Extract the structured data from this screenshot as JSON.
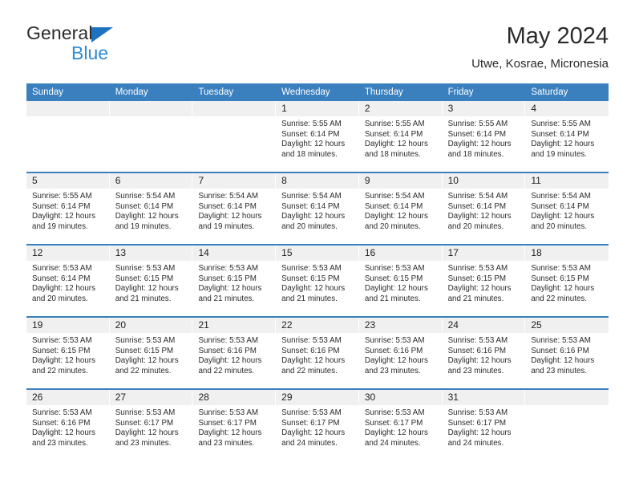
{
  "brand": {
    "name_part1": "General",
    "name_part2": "Blue",
    "accent_color": "#2e8bd4",
    "triangle_color": "#1d72c2"
  },
  "header": {
    "title": "May 2024",
    "subtitle": "Utwe, Kosrae, Micronesia"
  },
  "calendar": {
    "header_color": "#3a7fbe",
    "day_band_color": "#f0f0f0",
    "weekdays": [
      "Sunday",
      "Monday",
      "Tuesday",
      "Wednesday",
      "Thursday",
      "Friday",
      "Saturday"
    ],
    "weeks": [
      [
        {
          "day": "",
          "empty": true,
          "lines": []
        },
        {
          "day": "",
          "empty": true,
          "lines": []
        },
        {
          "day": "",
          "empty": true,
          "lines": []
        },
        {
          "day": "1",
          "lines": [
            "Sunrise: 5:55 AM",
            "Sunset: 6:14 PM",
            "Daylight: 12 hours",
            "and 18 minutes."
          ]
        },
        {
          "day": "2",
          "lines": [
            "Sunrise: 5:55 AM",
            "Sunset: 6:14 PM",
            "Daylight: 12 hours",
            "and 18 minutes."
          ]
        },
        {
          "day": "3",
          "lines": [
            "Sunrise: 5:55 AM",
            "Sunset: 6:14 PM",
            "Daylight: 12 hours",
            "and 18 minutes."
          ]
        },
        {
          "day": "4",
          "lines": [
            "Sunrise: 5:55 AM",
            "Sunset: 6:14 PM",
            "Daylight: 12 hours",
            "and 19 minutes."
          ]
        }
      ],
      [
        {
          "day": "5",
          "lines": [
            "Sunrise: 5:55 AM",
            "Sunset: 6:14 PM",
            "Daylight: 12 hours",
            "and 19 minutes."
          ]
        },
        {
          "day": "6",
          "lines": [
            "Sunrise: 5:54 AM",
            "Sunset: 6:14 PM",
            "Daylight: 12 hours",
            "and 19 minutes."
          ]
        },
        {
          "day": "7",
          "lines": [
            "Sunrise: 5:54 AM",
            "Sunset: 6:14 PM",
            "Daylight: 12 hours",
            "and 19 minutes."
          ]
        },
        {
          "day": "8",
          "lines": [
            "Sunrise: 5:54 AM",
            "Sunset: 6:14 PM",
            "Daylight: 12 hours",
            "and 20 minutes."
          ]
        },
        {
          "day": "9",
          "lines": [
            "Sunrise: 5:54 AM",
            "Sunset: 6:14 PM",
            "Daylight: 12 hours",
            "and 20 minutes."
          ]
        },
        {
          "day": "10",
          "lines": [
            "Sunrise: 5:54 AM",
            "Sunset: 6:14 PM",
            "Daylight: 12 hours",
            "and 20 minutes."
          ]
        },
        {
          "day": "11",
          "lines": [
            "Sunrise: 5:54 AM",
            "Sunset: 6:14 PM",
            "Daylight: 12 hours",
            "and 20 minutes."
          ]
        }
      ],
      [
        {
          "day": "12",
          "lines": [
            "Sunrise: 5:53 AM",
            "Sunset: 6:14 PM",
            "Daylight: 12 hours",
            "and 20 minutes."
          ]
        },
        {
          "day": "13",
          "lines": [
            "Sunrise: 5:53 AM",
            "Sunset: 6:15 PM",
            "Daylight: 12 hours",
            "and 21 minutes."
          ]
        },
        {
          "day": "14",
          "lines": [
            "Sunrise: 5:53 AM",
            "Sunset: 6:15 PM",
            "Daylight: 12 hours",
            "and 21 minutes."
          ]
        },
        {
          "day": "15",
          "lines": [
            "Sunrise: 5:53 AM",
            "Sunset: 6:15 PM",
            "Daylight: 12 hours",
            "and 21 minutes."
          ]
        },
        {
          "day": "16",
          "lines": [
            "Sunrise: 5:53 AM",
            "Sunset: 6:15 PM",
            "Daylight: 12 hours",
            "and 21 minutes."
          ]
        },
        {
          "day": "17",
          "lines": [
            "Sunrise: 5:53 AM",
            "Sunset: 6:15 PM",
            "Daylight: 12 hours",
            "and 21 minutes."
          ]
        },
        {
          "day": "18",
          "lines": [
            "Sunrise: 5:53 AM",
            "Sunset: 6:15 PM",
            "Daylight: 12 hours",
            "and 22 minutes."
          ]
        }
      ],
      [
        {
          "day": "19",
          "lines": [
            "Sunrise: 5:53 AM",
            "Sunset: 6:15 PM",
            "Daylight: 12 hours",
            "and 22 minutes."
          ]
        },
        {
          "day": "20",
          "lines": [
            "Sunrise: 5:53 AM",
            "Sunset: 6:15 PM",
            "Daylight: 12 hours",
            "and 22 minutes."
          ]
        },
        {
          "day": "21",
          "lines": [
            "Sunrise: 5:53 AM",
            "Sunset: 6:16 PM",
            "Daylight: 12 hours",
            "and 22 minutes."
          ]
        },
        {
          "day": "22",
          "lines": [
            "Sunrise: 5:53 AM",
            "Sunset: 6:16 PM",
            "Daylight: 12 hours",
            "and 22 minutes."
          ]
        },
        {
          "day": "23",
          "lines": [
            "Sunrise: 5:53 AM",
            "Sunset: 6:16 PM",
            "Daylight: 12 hours",
            "and 23 minutes."
          ]
        },
        {
          "day": "24",
          "lines": [
            "Sunrise: 5:53 AM",
            "Sunset: 6:16 PM",
            "Daylight: 12 hours",
            "and 23 minutes."
          ]
        },
        {
          "day": "25",
          "lines": [
            "Sunrise: 5:53 AM",
            "Sunset: 6:16 PM",
            "Daylight: 12 hours",
            "and 23 minutes."
          ]
        }
      ],
      [
        {
          "day": "26",
          "lines": [
            "Sunrise: 5:53 AM",
            "Sunset: 6:16 PM",
            "Daylight: 12 hours",
            "and 23 minutes."
          ]
        },
        {
          "day": "27",
          "lines": [
            "Sunrise: 5:53 AM",
            "Sunset: 6:17 PM",
            "Daylight: 12 hours",
            "and 23 minutes."
          ]
        },
        {
          "day": "28",
          "lines": [
            "Sunrise: 5:53 AM",
            "Sunset: 6:17 PM",
            "Daylight: 12 hours",
            "and 23 minutes."
          ]
        },
        {
          "day": "29",
          "lines": [
            "Sunrise: 5:53 AM",
            "Sunset: 6:17 PM",
            "Daylight: 12 hours",
            "and 24 minutes."
          ]
        },
        {
          "day": "30",
          "lines": [
            "Sunrise: 5:53 AM",
            "Sunset: 6:17 PM",
            "Daylight: 12 hours",
            "and 24 minutes."
          ]
        },
        {
          "day": "31",
          "lines": [
            "Sunrise: 5:53 AM",
            "Sunset: 6:17 PM",
            "Daylight: 12 hours",
            "and 24 minutes."
          ]
        },
        {
          "day": "",
          "empty": true,
          "lines": []
        }
      ]
    ]
  }
}
